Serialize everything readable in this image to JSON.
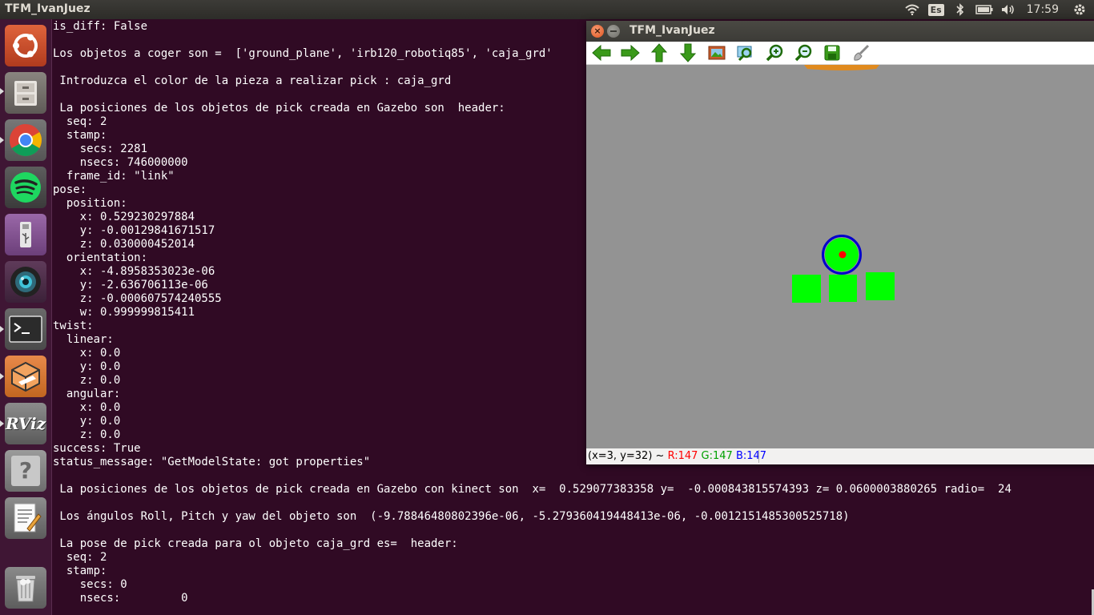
{
  "top_panel": {
    "title": "TFM_IvanJuez",
    "keyboard_layout": "Es",
    "clock": "17:59",
    "icons": [
      "wifi-icon",
      "keyboard-icon",
      "bluetooth-icon",
      "battery-icon",
      "volume-icon",
      "gear-icon"
    ]
  },
  "launcher": {
    "items": [
      {
        "name": "dash-home",
        "icon": "ubuntu-logo-icon"
      },
      {
        "name": "files",
        "icon": "file-cabinet-icon"
      },
      {
        "name": "chrome",
        "icon": "chrome-icon"
      },
      {
        "name": "spotify",
        "icon": "spotify-icon"
      },
      {
        "name": "usb-drive",
        "icon": "usb-icon"
      },
      {
        "name": "camera",
        "icon": "camera-icon"
      },
      {
        "name": "terminal",
        "icon": "terminal-icon",
        "glyph": ">_"
      },
      {
        "name": "gazebo",
        "icon": "gazebo-box-icon"
      },
      {
        "name": "rviz",
        "icon": "rviz-icon",
        "label": "RViz"
      },
      {
        "name": "help",
        "icon": "help-icon",
        "glyph": "?"
      },
      {
        "name": "text-editor",
        "icon": "text-editor-icon"
      },
      {
        "name": "trash",
        "icon": "trash-icon"
      }
    ]
  },
  "terminal": {
    "lines": [
      "is_diff: False",
      "",
      "Los objetos a coger son =  ['ground_plane', 'irb120_robotiq85', 'caja_grd'",
      "",
      " Introduzca el color de la pieza a realizar pick : caja_grd",
      "",
      " La posiciones de los objetos de pick creada en Gazebo son  header:",
      "  seq: 2",
      "  stamp:",
      "    secs: 2281",
      "    nsecs: 746000000",
      "  frame_id: \"link\"",
      "pose:",
      "  position:",
      "    x: 0.529230297884",
      "    y: -0.00129841671517",
      "    z: 0.030000452014",
      "  orientation:",
      "    x: -4.8958353023e-06",
      "    y: -2.636706113e-06",
      "    z: -0.000607574240555",
      "    w: 0.999999815411",
      "twist:",
      "  linear:",
      "    x: 0.0",
      "    y: 0.0",
      "    z: 0.0",
      "  angular:",
      "    x: 0.0",
      "    y: 0.0",
      "    z: 0.0",
      "success: True",
      "status_message: \"GetModelState: got properties\"",
      "",
      " La posiciones de los objetos de pick creada en Gazebo con kinect son  x=  0.529077383358 y=  -0.000843815574393 z= 0.0600003880265 radio=  24",
      "",
      " Los ángulos Roll, Pitch y yaw del objeto son  (-9.78846480802396e-06, -5.279360419448413e-06, -0.0012151485300525718)",
      "",
      " La pose de pick creada para ol objeto caja_grd es=  header:",
      "  seq: 2",
      "  stamp:",
      "    secs: 0",
      "    nsecs:         0"
    ]
  },
  "image_viewer": {
    "title": "TFM_IvanJuez",
    "toolbar": [
      {
        "name": "back-button",
        "icon": "arrow-left-icon"
      },
      {
        "name": "forward-button",
        "icon": "arrow-right-icon"
      },
      {
        "name": "up-button",
        "icon": "arrow-up-icon"
      },
      {
        "name": "down-button",
        "icon": "arrow-down-icon"
      },
      {
        "name": "fit-image-button",
        "icon": "image-icon"
      },
      {
        "name": "zoom-fit-button",
        "icon": "zoom-fit-icon"
      },
      {
        "name": "zoom-in-button",
        "icon": "zoom-in-icon"
      },
      {
        "name": "zoom-out-button",
        "icon": "zoom-out-icon"
      },
      {
        "name": "save-button",
        "icon": "save-icon"
      },
      {
        "name": "brush-button",
        "icon": "brush-icon"
      }
    ],
    "status": {
      "position": "(x=3, y=32) ~ ",
      "r": "R:147",
      "g": "G:147",
      "b": "B:147",
      "r_color": "#ff0000",
      "g_color": "#00a000",
      "b_color": "#0000ff"
    },
    "scene_colors": {
      "background": "#939393",
      "boxes": "#00ff00",
      "circle_outline": "#0000cc",
      "center_dot": "#ff0000"
    }
  }
}
